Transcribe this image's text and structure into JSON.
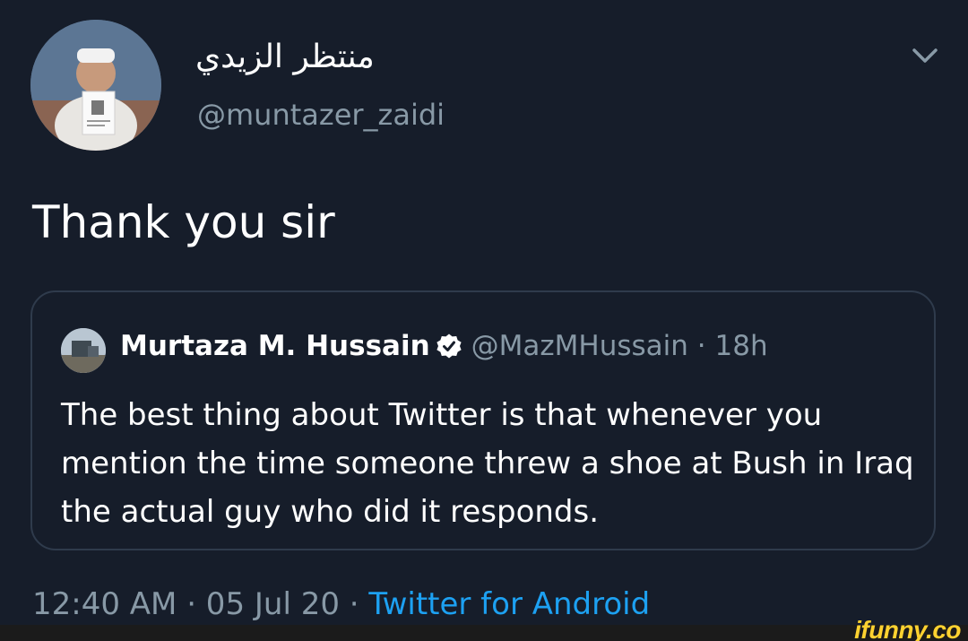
{
  "tweet": {
    "author": {
      "display_name": "منتظر الزيدي",
      "handle": "@muntazer_zaidi",
      "avatar": "avatar-photo"
    },
    "menu_icon": "chevron-down-icon",
    "text": "Thank you sir",
    "quoted_tweet": {
      "author_name": "Murtaza M. Hussain",
      "verified_icon": "verified-badge-icon",
      "handle": "@MazMHussain",
      "separator": "·",
      "time": "18h",
      "text": "The best thing about Twitter is that whenever you mention the time someone threw a shoe at Bush in Iraq the actual guy who did it responds."
    },
    "meta": {
      "time": "12:40 AM · 05 Jul 20",
      "separator": "·",
      "source": "Twitter for Android"
    }
  },
  "watermark": {
    "text": "ifunny.co"
  },
  "colors": {
    "background": "#161d2a",
    "secondary_text": "#8899a6",
    "link": "#1da1f2",
    "watermark": "#ffd230"
  }
}
